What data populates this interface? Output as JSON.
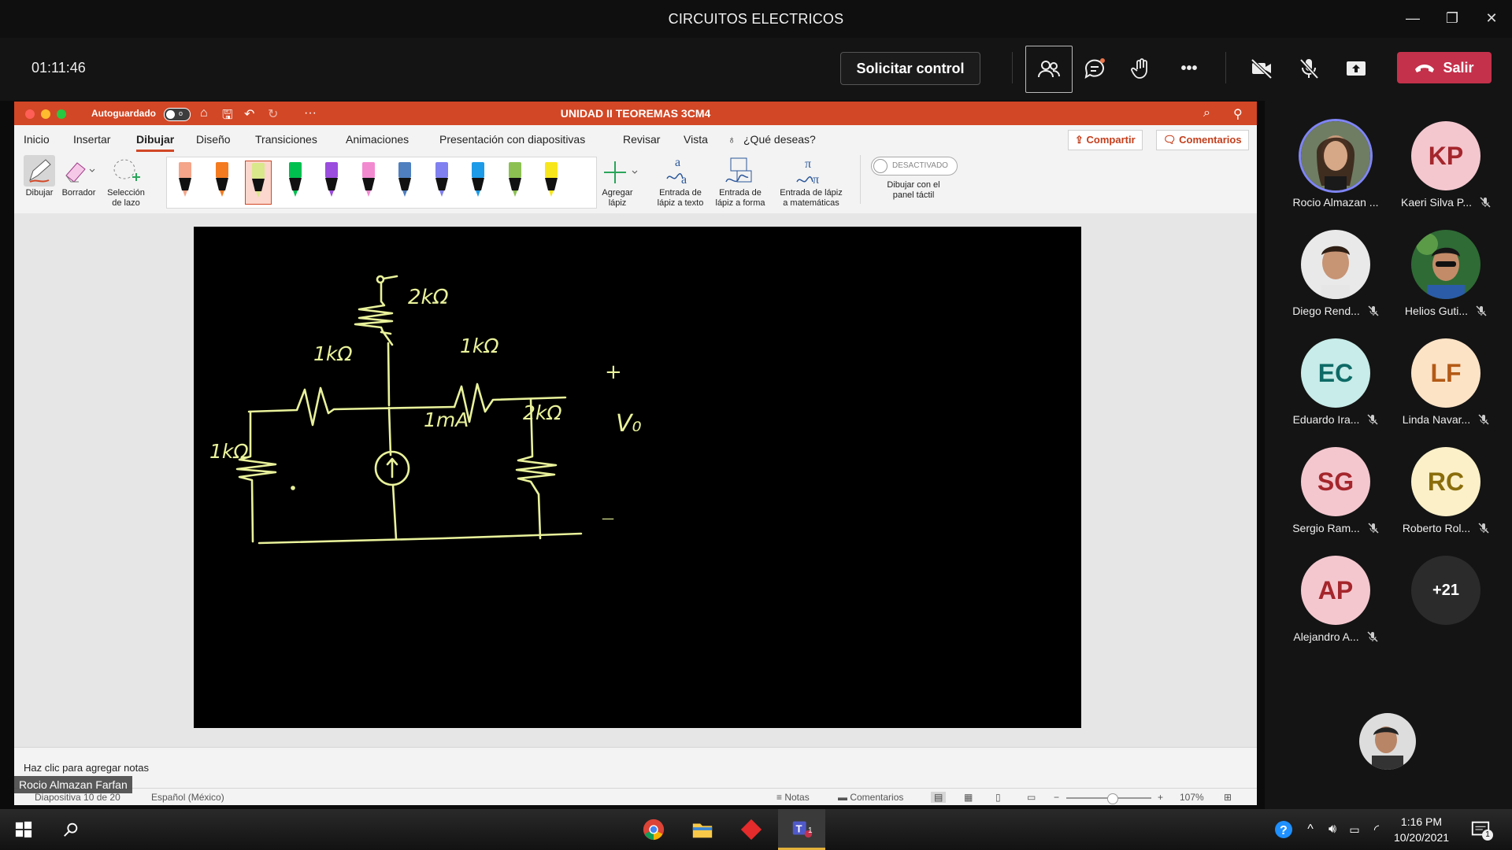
{
  "window": {
    "title": "CIRCUITOS ELECTRICOS",
    "minimize": "—",
    "restore": "❐",
    "close": "✕"
  },
  "meeting": {
    "timer": "01:11:46",
    "request_control": "Solicitar control",
    "more": "•••",
    "leave": "Salir",
    "leave_color": "#c4314b"
  },
  "powerpoint": {
    "autosave_label": "Autoguardado",
    "autosave_state": "o",
    "doc_title": "UNIDAD II TEOREMAS 3CM4",
    "accent": "#d24726",
    "tabs": [
      "Inicio",
      "Insertar",
      "Dibujar",
      "Diseño",
      "Transiciones",
      "Animaciones",
      "Presentación con diapositivas",
      "Revisar",
      "Vista"
    ],
    "active_tab": "Dibujar",
    "search_hint": "¿Qué deseas?",
    "share": "Compartir",
    "comments": "Comentarios",
    "ribbon": {
      "draw": "Dibujar",
      "eraser": "Borrador",
      "lasso_line1": "Selección",
      "lasso_line2": "de lazo",
      "add_pen_line1": "Agregar",
      "add_pen_line2": "lápiz",
      "ink_text_line1": "Entrada de",
      "ink_text_line2": "lápiz a texto",
      "ink_shape_line1": "Entrada de",
      "ink_shape_line2": "lápiz a forma",
      "ink_math_line1": "Entrada de lápiz",
      "ink_math_line2": "a matemáticas",
      "touch_state": "DESACTIVADO",
      "touch_line1": "Dibujar con el",
      "touch_line2": "panel táctil",
      "pens": [
        {
          "color": "#f4a58a",
          "selected": false
        },
        {
          "color": "#f47b20",
          "selected": false
        },
        {
          "color": "#d9e88a",
          "selected": true
        },
        {
          "color": "#00c050",
          "selected": false
        },
        {
          "color": "#9b4dde",
          "selected": false
        },
        {
          "color": "#f28ad0",
          "selected": false
        },
        {
          "color": "#4f7fbf",
          "selected": false
        },
        {
          "color": "#8080f0",
          "selected": false
        },
        {
          "color": "#1e9be8",
          "selected": false
        },
        {
          "color": "#8cc152",
          "selected": false
        },
        {
          "color": "#f8e61c",
          "selected": false
        }
      ]
    },
    "slide": {
      "labels": {
        "r_top": "2kΩ",
        "r_left_top": "1kΩ",
        "r_right_top": "1kΩ",
        "r_left": "1kΩ",
        "r_right": "2kΩ",
        "source": "1mA",
        "plus": "+",
        "vout": "V₀",
        "minus": "—"
      },
      "ink_color": "#e9f29a"
    },
    "notes_placeholder": "Haz clic para agregar notas",
    "status": {
      "slide": "Diapositiva 10 de 20",
      "language": "Español (México)",
      "notes": "Notas",
      "comments": "Comentarios",
      "zoom": "107%"
    },
    "presenter_name": "Rocio Almazan Farfan"
  },
  "participants": [
    {
      "name": "Rocio Almazan ...",
      "initials": "",
      "photo": "rocio",
      "muted": false,
      "active": true
    },
    {
      "name": "Kaeri Silva P...",
      "initials": "KP",
      "bg": "#f4c7cf",
      "fg": "#a4262c",
      "muted": true
    },
    {
      "name": "Diego Rend...",
      "initials": "",
      "photo": "diego",
      "muted": true
    },
    {
      "name": "Helios Guti...",
      "initials": "",
      "photo": "helios",
      "muted": true
    },
    {
      "name": "Eduardo Ira...",
      "initials": "EC",
      "bg": "#c7ece9",
      "fg": "#0e6a66",
      "muted": true
    },
    {
      "name": "Linda Navar...",
      "initials": "LF",
      "bg": "#fde3c6",
      "fg": "#b35a16",
      "muted": true
    },
    {
      "name": "Sergio Ram...",
      "initials": "SG",
      "bg": "#f4c7cf",
      "fg": "#a4262c",
      "muted": true
    },
    {
      "name": "Roberto Rol...",
      "initials": "RC",
      "bg": "#fbf0c8",
      "fg": "#8a6d0b",
      "muted": true
    },
    {
      "name": "Alejandro A...",
      "initials": "AP",
      "bg": "#f4c7cf",
      "fg": "#a4262c",
      "muted": true
    },
    {
      "name": "",
      "initials": "+21",
      "bg": "#2b2b2b",
      "fg": "#ffffff",
      "muted": false
    }
  ],
  "taskbar": {
    "time": "1:16 PM",
    "date": "10/20/2021",
    "notification_count": "1",
    "teams_badge": "1"
  }
}
